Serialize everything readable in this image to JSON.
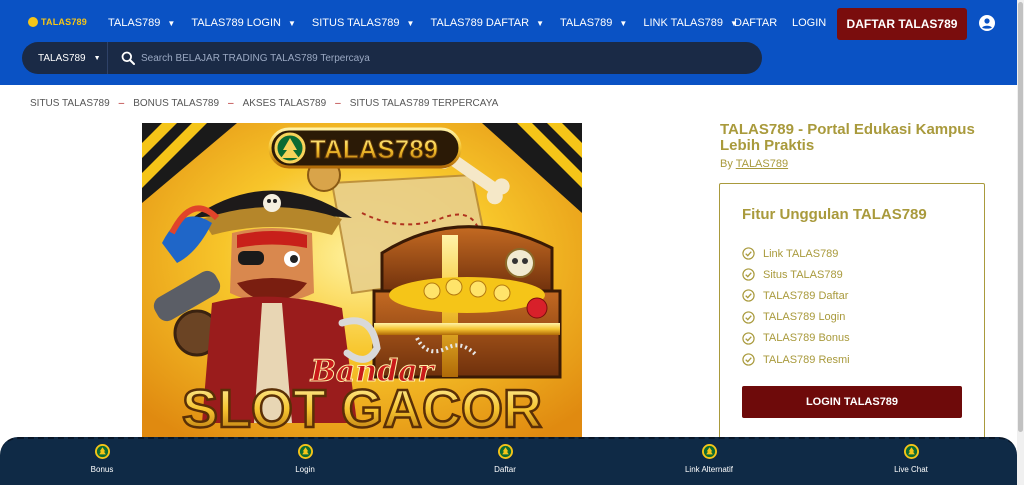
{
  "header": {
    "logo_text": "TALAS789",
    "nav": [
      {
        "label": "TALAS789"
      },
      {
        "label": "TALAS789 LOGIN"
      },
      {
        "label": "SITUS TALAS789"
      },
      {
        "label": "TALAS789 DAFTAR"
      },
      {
        "label": "TALAS789"
      },
      {
        "label": "LINK TALAS789"
      }
    ],
    "daftar_link": "DAFTAR",
    "login_link": "LOGIN",
    "cta_button": "DAFTAR TALAS789",
    "colors": {
      "background": "#0a52c4",
      "cta": "#7a0d0d",
      "logo": "#f5c518"
    }
  },
  "search": {
    "category": "TALAS789",
    "placeholder": "Search BELAJAR TRADING TALAS789 Terpercaya"
  },
  "breadcrumb": [
    "SITUS TALAS789",
    "BONUS TALAS789",
    "AKSES TALAS789",
    "SITUS TALAS789 TERPERCAYA"
  ],
  "hero": {
    "brand": "TALAS789",
    "script_text": "Bandar",
    "headline": "SLOT GACOR"
  },
  "post": {
    "title": "TALAS789 - Portal Edukasi Kampus Lebih Praktis",
    "by_prefix": "By",
    "author": "TALAS789"
  },
  "card": {
    "title": "Fitur Unggulan TALAS789",
    "features": [
      "Link TALAS789",
      "Situs TALAS789",
      "TALAS789 Daftar",
      "TALAS789 Login",
      "TALAS789 Bonus",
      "TALAS789 Resmi"
    ],
    "button": "LOGIN TALAS789",
    "accent_color": "#a99a3c"
  },
  "bottom_bar": [
    {
      "label": "Bonus",
      "icon": "tree-coin-icon"
    },
    {
      "label": "Login",
      "icon": "tree-coin-icon"
    },
    {
      "label": "Daftar",
      "icon": "tree-coin-icon"
    },
    {
      "label": "Link Alternatif",
      "icon": "tree-coin-icon"
    },
    {
      "label": "Live Chat",
      "icon": "tree-coin-icon"
    }
  ]
}
